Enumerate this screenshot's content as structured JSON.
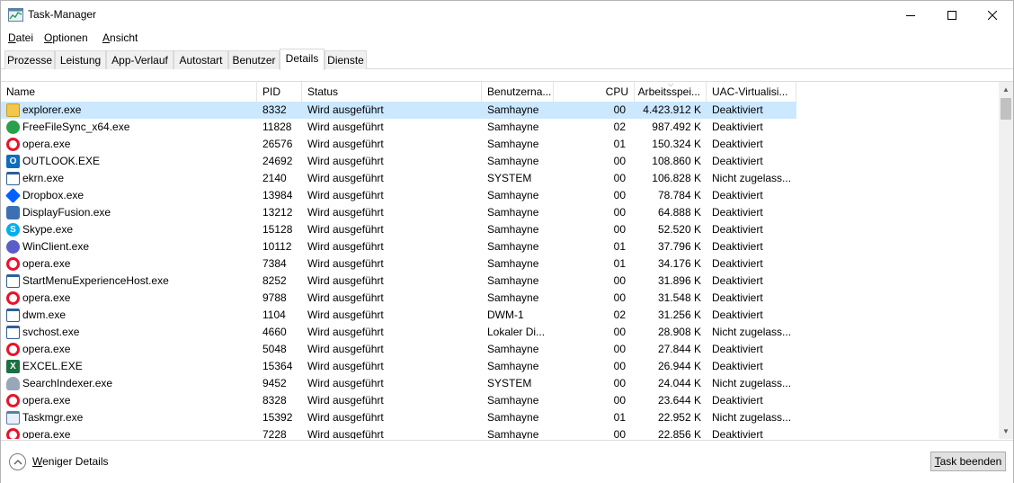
{
  "window": {
    "title": "Task-Manager"
  },
  "menu": [
    {
      "label": "Datei",
      "accel": "D",
      "rest": "atei"
    },
    {
      "label": "Optionen",
      "accel": "O",
      "rest": "ptionen"
    },
    {
      "label": "Ansicht",
      "accel": "A",
      "rest": "nsicht"
    }
  ],
  "tabs": [
    "Prozesse",
    "Leistung",
    "App-Verlauf",
    "Autostart",
    "Benutzer",
    "Details",
    "Dienste"
  ],
  "active_tab": "Details",
  "columns": {
    "name": "Name",
    "pid": "PID",
    "status": "Status",
    "user": "Benutzerna...",
    "cpu": "CPU",
    "memory": "Arbeitsspei...",
    "uac": "UAC-Virtualisi..."
  },
  "rows": [
    {
      "icon": "explorer-folder-icon",
      "name": "explorer.exe",
      "pid": "8332",
      "status": "Wird ausgeführt",
      "user": "Samhayne",
      "cpu": "00",
      "memory": "4.423.912 K",
      "uac": "Deaktiviert"
    },
    {
      "icon": "freefilesync-icon",
      "name": "FreeFileSync_x64.exe",
      "pid": "11828",
      "status": "Wird ausgeführt",
      "user": "Samhayne",
      "cpu": "02",
      "memory": "987.492 K",
      "uac": "Deaktiviert"
    },
    {
      "icon": "opera-icon",
      "name": "opera.exe",
      "pid": "26576",
      "status": "Wird ausgeführt",
      "user": "Samhayne",
      "cpu": "01",
      "memory": "150.324 K",
      "uac": "Deaktiviert"
    },
    {
      "icon": "outlook-icon",
      "name": "OUTLOOK.EXE",
      "pid": "24692",
      "status": "Wird ausgeführt",
      "user": "Samhayne",
      "cpu": "00",
      "memory": "108.860 K",
      "uac": "Deaktiviert"
    },
    {
      "icon": "generic-window-icon",
      "name": "ekrn.exe",
      "pid": "2140",
      "status": "Wird ausgeführt",
      "user": "SYSTEM",
      "cpu": "00",
      "memory": "106.828 K",
      "uac": "Nicht zugelass..."
    },
    {
      "icon": "dropbox-icon",
      "name": "Dropbox.exe",
      "pid": "13984",
      "status": "Wird ausgeführt",
      "user": "Samhayne",
      "cpu": "00",
      "memory": "78.784 K",
      "uac": "Deaktiviert"
    },
    {
      "icon": "displayfusion-icon",
      "name": "DisplayFusion.exe",
      "pid": "13212",
      "status": "Wird ausgeführt",
      "user": "Samhayne",
      "cpu": "00",
      "memory": "64.888 K",
      "uac": "Deaktiviert"
    },
    {
      "icon": "skype-icon",
      "name": "Skype.exe",
      "pid": "15128",
      "status": "Wird ausgeführt",
      "user": "Samhayne",
      "cpu": "00",
      "memory": "52.520 K",
      "uac": "Deaktiviert"
    },
    {
      "icon": "winclient-icon",
      "name": "WinClient.exe",
      "pid": "10112",
      "status": "Wird ausgeführt",
      "user": "Samhayne",
      "cpu": "01",
      "memory": "37.796 K",
      "uac": "Deaktiviert"
    },
    {
      "icon": "opera-icon",
      "name": "opera.exe",
      "pid": "7384",
      "status": "Wird ausgeführt",
      "user": "Samhayne",
      "cpu": "01",
      "memory": "34.176 K",
      "uac": "Deaktiviert"
    },
    {
      "icon": "generic-window-icon",
      "name": "StartMenuExperienceHost.exe",
      "pid": "8252",
      "status": "Wird ausgeführt",
      "user": "Samhayne",
      "cpu": "00",
      "memory": "31.896 K",
      "uac": "Deaktiviert"
    },
    {
      "icon": "opera-icon",
      "name": "opera.exe",
      "pid": "9788",
      "status": "Wird ausgeführt",
      "user": "Samhayne",
      "cpu": "00",
      "memory": "31.548 K",
      "uac": "Deaktiviert"
    },
    {
      "icon": "generic-window-icon",
      "name": "dwm.exe",
      "pid": "1104",
      "status": "Wird ausgeführt",
      "user": "DWM-1",
      "cpu": "02",
      "memory": "31.256 K",
      "uac": "Deaktiviert"
    },
    {
      "icon": "generic-window-icon",
      "name": "svchost.exe",
      "pid": "4660",
      "status": "Wird ausgeführt",
      "user": "Lokaler Di...",
      "cpu": "00",
      "memory": "28.908 K",
      "uac": "Nicht zugelass..."
    },
    {
      "icon": "opera-icon",
      "name": "opera.exe",
      "pid": "5048",
      "status": "Wird ausgeführt",
      "user": "Samhayne",
      "cpu": "00",
      "memory": "27.844 K",
      "uac": "Deaktiviert"
    },
    {
      "icon": "excel-icon",
      "name": "EXCEL.EXE",
      "pid": "15364",
      "status": "Wird ausgeführt",
      "user": "Samhayne",
      "cpu": "00",
      "memory": "26.944 K",
      "uac": "Deaktiviert"
    },
    {
      "icon": "search-indexer-icon",
      "name": "SearchIndexer.exe",
      "pid": "9452",
      "status": "Wird ausgeführt",
      "user": "SYSTEM",
      "cpu": "00",
      "memory": "24.044 K",
      "uac": "Nicht zugelass..."
    },
    {
      "icon": "opera-icon",
      "name": "opera.exe",
      "pid": "8328",
      "status": "Wird ausgeführt",
      "user": "Samhayne",
      "cpu": "00",
      "memory": "23.644 K",
      "uac": "Deaktiviert"
    },
    {
      "icon": "taskmgr-icon",
      "name": "Taskmgr.exe",
      "pid": "15392",
      "status": "Wird ausgeführt",
      "user": "Samhayne",
      "cpu": "01",
      "memory": "22.952 K",
      "uac": "Nicht zugelass..."
    },
    {
      "icon": "opera-icon",
      "name": "opera.exe",
      "pid": "7228",
      "status": "Wird ausgeführt",
      "user": "Samhayne",
      "cpu": "00",
      "memory": "22.856 K",
      "uac": "Deaktiviert"
    }
  ],
  "selected_row": 0,
  "footer": {
    "fewer_details": "Weniger Details",
    "fewer_accel": "W",
    "fewer_rest": "eniger Details",
    "end_task": "Task beenden",
    "end_task_accel": "T",
    "end_task_rest": "ask beenden"
  },
  "colors": {
    "selection": "#cce8ff",
    "opera": "#e8132b",
    "outlook": "#0f6cbd",
    "excel": "#1d6f42",
    "dropbox": "#0061ff",
    "skype": "#00aff0"
  }
}
